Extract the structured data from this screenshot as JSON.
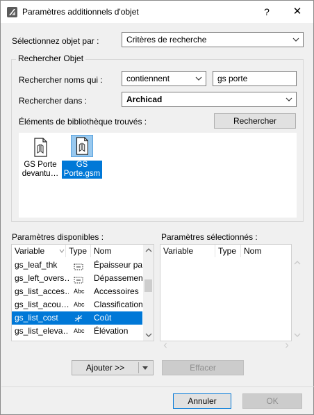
{
  "window": {
    "title": "Paramètres additionnels d'objet",
    "help_label": "?",
    "close_label": "✕"
  },
  "select_by": {
    "label": "Sélectionnez objet par :",
    "value": "Critères de recherche"
  },
  "search": {
    "group_label": "Rechercher Objet",
    "names_label": "Rechercher noms qui :",
    "match_mode": "contiennent",
    "query": "gs porte",
    "location_label": "Rechercher dans :",
    "location": "Archicad",
    "found_label": "Éléments de bibliothèque trouvés :",
    "search_button": "Rechercher",
    "results": [
      {
        "line1": "GS Porte",
        "line2": "devantu…",
        "selected": false
      },
      {
        "line1": "GS",
        "line2": "Porte.gsm",
        "selected": true
      }
    ]
  },
  "available": {
    "label": "Paramètres disponibles :",
    "columns": [
      "Variable",
      "Type",
      "Nom"
    ],
    "rows": [
      {
        "variable": "gs_leaf_thk",
        "type_icon": "dimension-dotted-icon",
        "name": "Épaisseur pa…",
        "selected": false
      },
      {
        "variable": "gs_left_overs…",
        "type_icon": "dimension-dotted-icon",
        "name": "Dépassemen…",
        "selected": false
      },
      {
        "variable": "gs_list_acces…",
        "type": "Abc",
        "name": "Accessoires",
        "selected": false
      },
      {
        "variable": "gs_list_acou…",
        "type": "Abc",
        "name": "Classification.",
        "selected": false
      },
      {
        "variable": "gs_list_cost",
        "type_icon": "real-number-icon",
        "name": "Coût",
        "selected": true
      },
      {
        "variable": "gs_list_eleva…",
        "type": "Abc",
        "name": "Élévation",
        "selected": false
      }
    ]
  },
  "selected": {
    "label": "Paramètres sélectionnés :",
    "columns": [
      "Variable",
      "Type",
      "Nom"
    ]
  },
  "buttons": {
    "add": "Ajouter >>",
    "clear": "Effacer",
    "cancel": "Annuler",
    "ok": "OK"
  },
  "colors": {
    "accent": "#0078d7",
    "selection_light": "#99c9ef"
  }
}
